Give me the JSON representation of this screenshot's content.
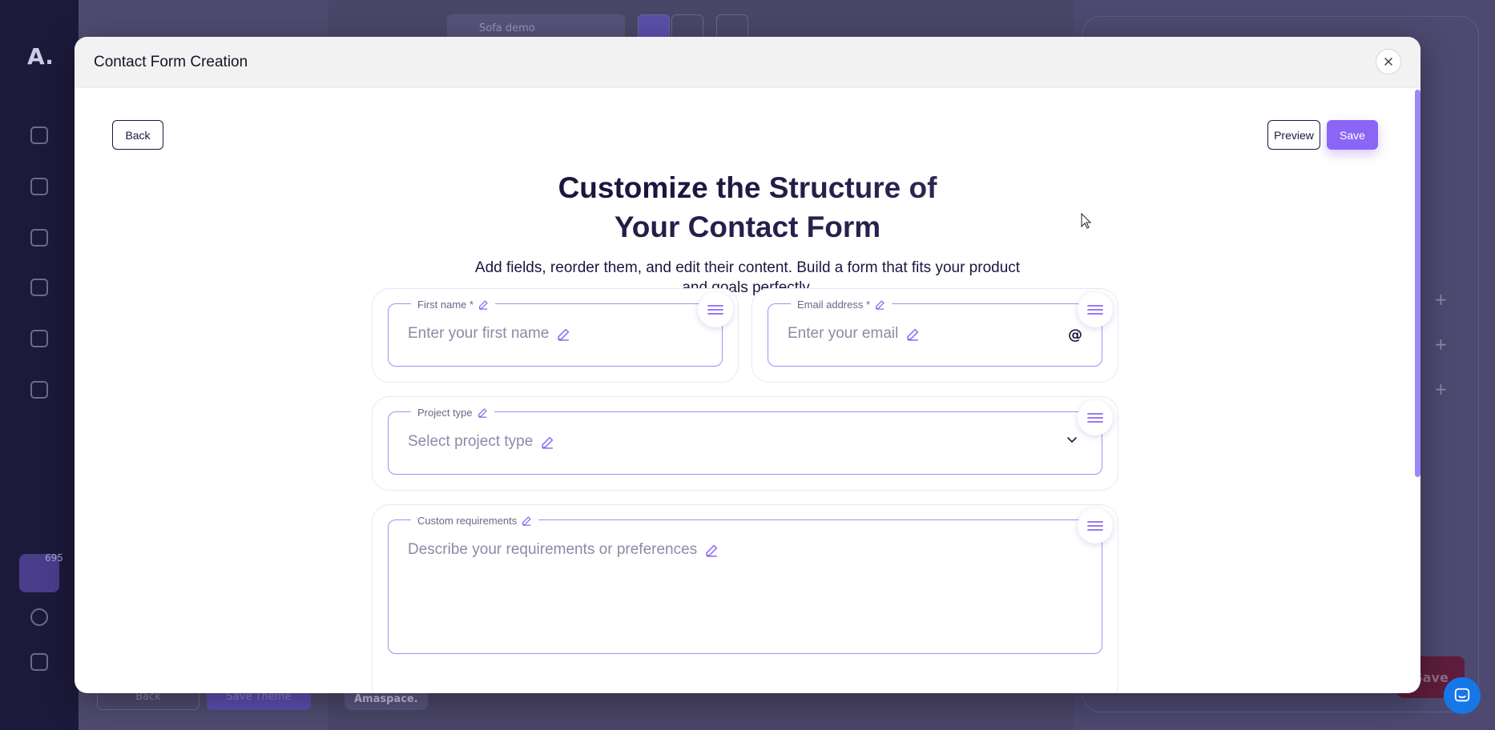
{
  "background": {
    "rail_logo": "A.",
    "rail_badge": "695",
    "canvas_select": "Sofa demo",
    "back_label": "Back",
    "save_theme_label": "Save Theme",
    "footer_tag": "Amaspace.",
    "right_save_label": "Save"
  },
  "modal": {
    "title": "Contact Form Creation",
    "close_icon": "close-icon",
    "back_label": "Back",
    "preview_label": "Preview",
    "save_label": "Save",
    "heading_line1": "Customize the Structure of",
    "heading_line2": "Your Contact Form",
    "sub_line1": "Add fields, reorder them, and edit their content. Build a form that fits your product",
    "sub_line2": "and goals perfectly."
  },
  "fields": {
    "first_name": {
      "label": "First name *",
      "placeholder": "Enter your first name"
    },
    "email": {
      "label": "Email address *",
      "placeholder": "Enter your email",
      "suffix": "@"
    },
    "project_type": {
      "label": "Project type",
      "placeholder": "Select project type"
    },
    "custom_requirements": {
      "label": "Custom requirements",
      "placeholder": "Describe your requirements or preferences"
    }
  },
  "colors": {
    "accent": "#8b66f5",
    "field_border": "#a48ef3",
    "text_dark": "#1b1640",
    "placeholder": "#8e89a8"
  }
}
